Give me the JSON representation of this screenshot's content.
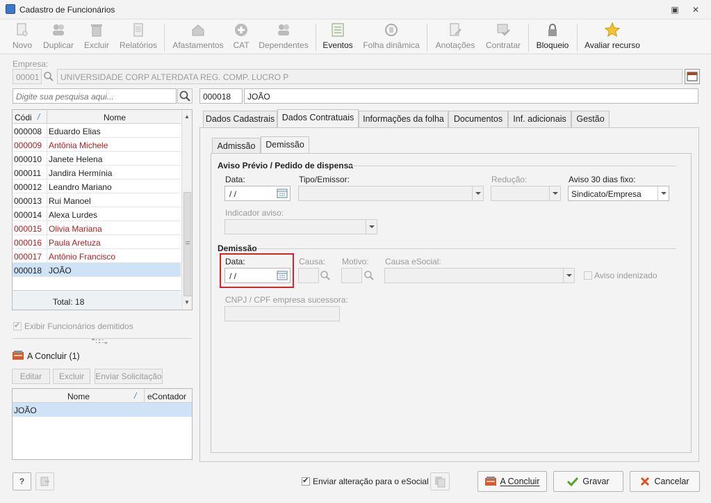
{
  "window": {
    "title": "Cadastro de Funcionários"
  },
  "toolbar": {
    "novo": "Novo",
    "duplicar": "Duplicar",
    "excluir": "Excluir",
    "relatorios": "Relatórios",
    "afastamentos": "Afastamentos",
    "cat": "CAT",
    "dependentes": "Dependentes",
    "eventos": "Eventos",
    "folha_dinamica": "Folha dinâmica",
    "anotacoes": "Anotações",
    "contratar": "Contratar",
    "bloqueio": "Bloqueio",
    "avaliar_recurso": "Avaliar recurso"
  },
  "empresa": {
    "label": "Empresa:",
    "code": "00001",
    "name": "UNIVERSIDADE CORP ALTERDATA REG. COMP. LUCRO P"
  },
  "search": {
    "placeholder": "Digite sua pesquisa aqui..."
  },
  "selected": {
    "code": "000018",
    "name": "JOÃO"
  },
  "list": {
    "col_code": "Códi",
    "col_name": "Nome",
    "sort_indicator": "/",
    "rows": [
      {
        "code": "000008",
        "name": "Eduardo Elias",
        "red": false
      },
      {
        "code": "000009",
        "name": "Antônia Michele",
        "red": true
      },
      {
        "code": "000010",
        "name": "Janete Helena",
        "red": false
      },
      {
        "code": "000011",
        "name": "Jandira Hermínia",
        "red": false
      },
      {
        "code": "000012",
        "name": "Leandro Mariano",
        "red": false
      },
      {
        "code": "000013",
        "name": "Rui Manoel",
        "red": false
      },
      {
        "code": "000014",
        "name": "Alexa Lurdes",
        "red": false
      },
      {
        "code": "000015",
        "name": "Olivia Mariana",
        "red": true
      },
      {
        "code": "000016",
        "name": "Paula Aretuza",
        "red": true
      },
      {
        "code": "000017",
        "name": "Antônio Francisco",
        "red": true
      },
      {
        "code": "000018",
        "name": "JOÃO",
        "red": false,
        "selected": true
      }
    ],
    "total": "Total: 18"
  },
  "exibir_demitidos": "Exibir Funcionários demitidos",
  "a_concluir": {
    "title": "A Concluir (1)",
    "editar": "Editar",
    "excluir": "Excluir",
    "enviar_solicitacao": "Enviar Solicitação",
    "col_nome": "Nome",
    "col_econtador": "eContador",
    "rows": [
      {
        "nome": "JOÃO",
        "econtador": ""
      }
    ]
  },
  "tabs": {
    "dados_cadastrais": "Dados Cadastrais",
    "dados_contratuais": "Dados Contratuais",
    "informacoes_folha": "Informações da folha",
    "documentos": "Documentos",
    "inf_adicionais": "Inf. adicionais",
    "gestao": "Gestão"
  },
  "subtabs": {
    "admissao": "Admissão",
    "demissao": "Demissão"
  },
  "aviso": {
    "section": "Aviso Prévio / Pedido de dispensa",
    "data_label": "Data:",
    "data_value": "/ /",
    "tipo_label": "Tipo/Emissor:",
    "reducao_label": "Redução:",
    "aviso30_label": "Aviso 30 dias fixo:",
    "aviso30_value": "Sindicato/Empresa",
    "indicador_label": "Indicador aviso:"
  },
  "demissao": {
    "section": "Demissão",
    "data_label": "Data:",
    "data_value": "/ /",
    "causa_label": "Causa:",
    "motivo_label": "Motivo:",
    "causa_esocial_label": "Causa eSocial:",
    "aviso_indenizado": "Aviso indenizado",
    "cnpj_label": "CNPJ / CPF empresa sucessora:"
  },
  "footer": {
    "help": "?",
    "enviar_alteracao": "Enviar alteração para o eSocial",
    "a_concluir": "A Concluir",
    "gravar": "Gravar",
    "cancelar": "Cancelar"
  },
  "colors": {
    "highlight": "#d8232a",
    "selection": "#cfe3f6",
    "red_text": "#b51c1c"
  }
}
